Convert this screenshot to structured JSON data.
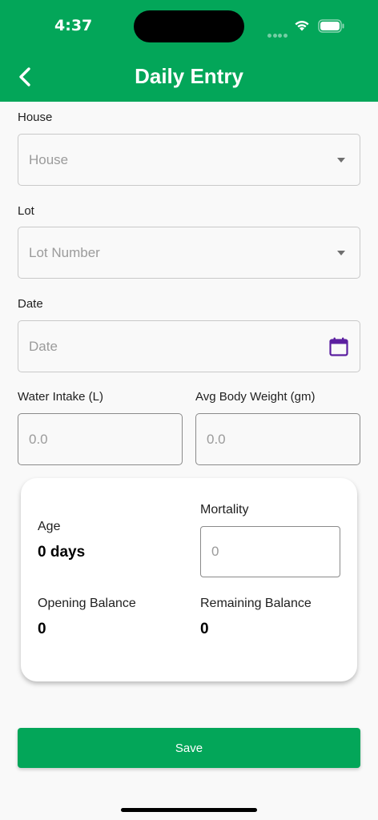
{
  "status_bar": {
    "time": "4:37"
  },
  "header": {
    "title": "Daily Entry"
  },
  "form": {
    "house": {
      "label": "House",
      "placeholder": "House"
    },
    "lot": {
      "label": "Lot",
      "placeholder": "Lot Number"
    },
    "date": {
      "label": "Date",
      "placeholder": "Date"
    },
    "water_intake": {
      "label": "Water Intake (L)",
      "placeholder": "0.0"
    },
    "avg_body_weight": {
      "label": "Avg Body Weight (gm)",
      "placeholder": "0.0"
    }
  },
  "summary": {
    "age_label": "Age",
    "age_value": "0 days",
    "mortality_label": "Mortality",
    "mortality_placeholder": "0",
    "opening_balance_label": "Opening Balance",
    "opening_balance_value": "0",
    "remaining_balance_label": "Remaining Balance",
    "remaining_balance_value": "0"
  },
  "actions": {
    "save_label": "Save"
  },
  "colors": {
    "brand": "#03a659",
    "calendar_icon": "#5b1fa0"
  }
}
